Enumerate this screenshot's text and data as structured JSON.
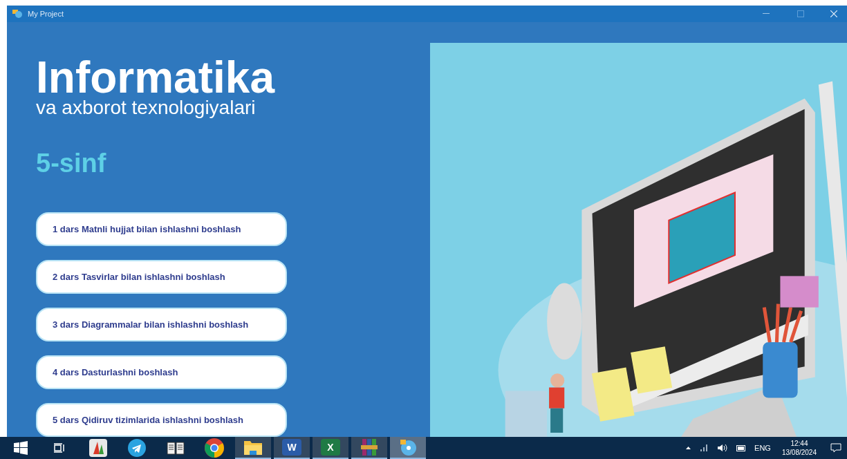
{
  "window": {
    "title": "My Project"
  },
  "hero": {
    "title": "Informatika",
    "subtitle": "va axborot texnologiyalari",
    "grade": "5-sinf"
  },
  "lessons": [
    "1 dars Matnli hujjat bilan ishlashni boshlash",
    "2 dars Tasvirlar bilan ishlashni boshlash",
    "3 dars Diagrammalar bilan ishlashni boshlash",
    "4 dars Dasturlashni boshlash",
    "5 dars Qidiruv tizimlarida ishlashni boshlash"
  ],
  "taskbar": {
    "items": [
      {
        "kind": "start",
        "open": false,
        "active": false
      },
      {
        "kind": "taskview",
        "open": false,
        "active": false
      },
      {
        "kind": "photo",
        "open": false,
        "active": false
      },
      {
        "kind": "telegram",
        "open": false,
        "active": false
      },
      {
        "kind": "book",
        "open": false,
        "active": false
      },
      {
        "kind": "chrome",
        "open": false,
        "active": false
      },
      {
        "kind": "folder",
        "open": true,
        "active": false
      },
      {
        "kind": "word",
        "label": "W",
        "open": true,
        "active": false
      },
      {
        "kind": "excel",
        "label": "X",
        "open": true,
        "active": false
      },
      {
        "kind": "archive",
        "open": true,
        "active": false
      },
      {
        "kind": "project",
        "open": true,
        "active": true
      }
    ],
    "language": "ENG",
    "time": "12:44",
    "date": "13/08/2024"
  }
}
